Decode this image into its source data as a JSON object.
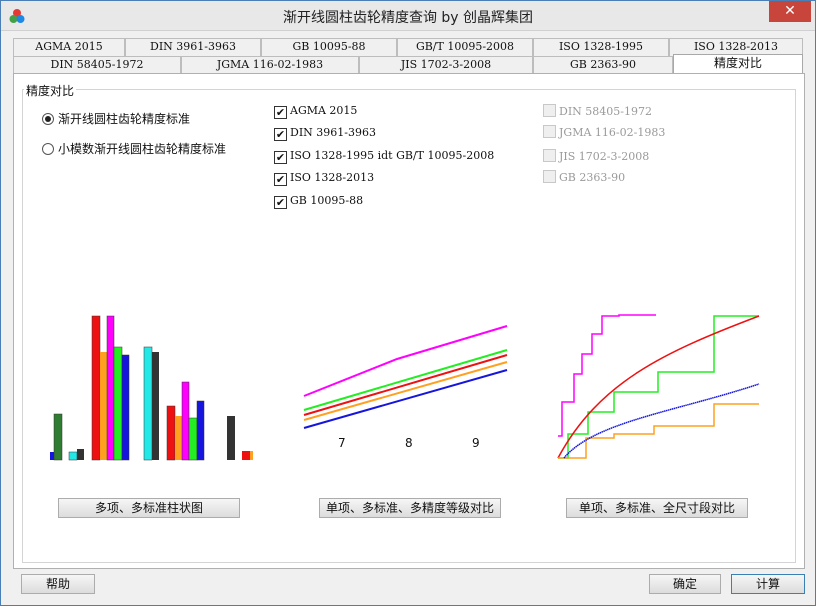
{
  "window": {
    "title": "渐开线圆柱齿轮精度查询 by 创晶辉集团",
    "close_glyph": "✕"
  },
  "tabs_row1": [
    "AGMA 2015",
    "DIN 3961-3963",
    "GB 10095-88",
    "GB/T 10095-2008",
    "ISO 1328-1995",
    "ISO 1328-2013"
  ],
  "tabs_row2": [
    "DIN 58405-1972",
    "JGMA 116-02-1983",
    "JIS 1702-3-2008",
    "GB 2363-90",
    "精度对比"
  ],
  "group": {
    "title": "精度对比"
  },
  "radios": [
    {
      "label": "渐开线圆柱齿轮精度标准",
      "selected": true
    },
    {
      "label": "小模数渐开线圆柱齿轮精度标准",
      "selected": false
    }
  ],
  "checks_enabled": [
    {
      "label": "AGMA 2015",
      "checked": true
    },
    {
      "label": "DIN 3961-3963",
      "checked": true
    },
    {
      "label": "ISO 1328-1995 idt GB/T 10095-2008",
      "checked": true
    },
    {
      "label": "ISO 1328-2013",
      "checked": true
    },
    {
      "label": "GB 10095-88",
      "checked": true
    }
  ],
  "checks_disabled": [
    {
      "label": "DIN 58405-1972",
      "checked": false
    },
    {
      "label": "JGMA 116-02-1983",
      "checked": false
    },
    {
      "label": "JIS 1702-3-2008",
      "checked": false
    },
    {
      "label": "GB 2363-90",
      "checked": false
    }
  ],
  "previews": {
    "bar_button": "多项、多标准柱状图",
    "grade_button": "单项、多标准、多精度等级对比",
    "size_button": "单项、多标准、全尺寸段对比",
    "grade_ticks": [
      "7",
      "8",
      "9"
    ]
  },
  "bottom": {
    "help": "帮助",
    "ok": "确定",
    "calc": "计算"
  },
  "colors": {
    "magenta": "#ff00ff",
    "green": "#22ee22",
    "red": "#ee1111",
    "orange": "#ffa020",
    "blue": "#1515dd",
    "cyan": "#22e8e8",
    "dark": "#333333",
    "darkgreen": "#2e7d32"
  }
}
